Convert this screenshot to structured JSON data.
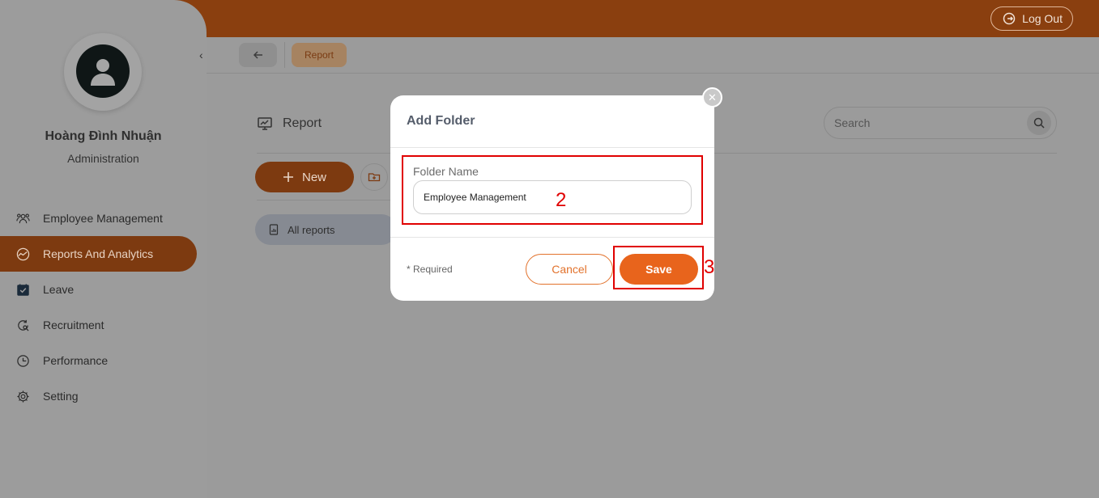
{
  "header": {
    "logout_label": "Log Out"
  },
  "sidebar": {
    "user_name": "Hoàng Đình Nhuận",
    "user_role": "Administration",
    "items": [
      {
        "label": "Employee Management",
        "icon": "people-icon"
      },
      {
        "label": "Reports And Analytics",
        "icon": "chart-icon",
        "active": true
      },
      {
        "label": "Leave",
        "icon": "calendar-check-icon"
      },
      {
        "label": "Recruitment",
        "icon": "recruitment-icon"
      },
      {
        "label": "Performance",
        "icon": "performance-icon"
      },
      {
        "label": "Setting",
        "icon": "gear-icon"
      }
    ]
  },
  "breadcrumb": {
    "current": "Report"
  },
  "page": {
    "title": "Report",
    "search_placeholder": "Search",
    "new_label": "New",
    "all_reports_label": "All reports"
  },
  "modal": {
    "title": "Add Folder",
    "field_label": "Folder Name",
    "field_value": "Employee Management",
    "required_note": "* Required",
    "cancel_label": "Cancel",
    "save_label": "Save"
  },
  "annotations": {
    "step_2": "2",
    "step_3": "3"
  },
  "colors": {
    "accent": "#e8641c",
    "annotation": "#e00000"
  }
}
